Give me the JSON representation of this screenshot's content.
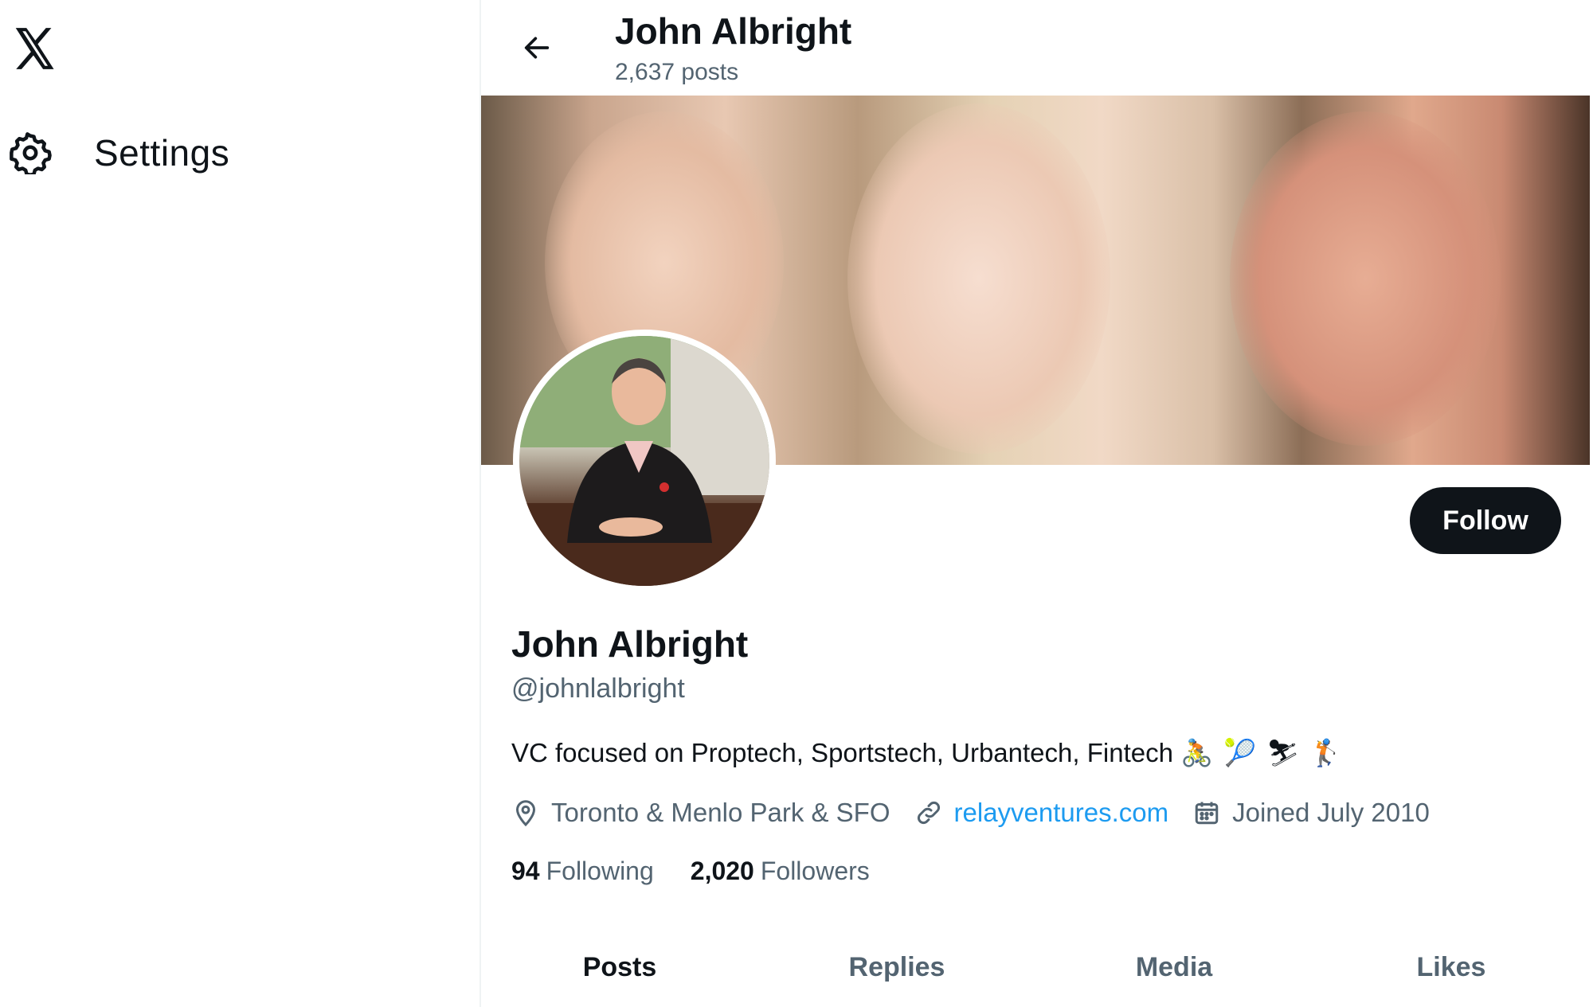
{
  "nav": {
    "settings_label": "Settings"
  },
  "header": {
    "name": "John Albright",
    "post_count": "2,637 posts"
  },
  "profile": {
    "name": "John Albright",
    "handle": "@johnlalbright",
    "bio": "VC focused on Proptech, Sportstech, Urbantech, Fintech",
    "bio_emojis": [
      "🚴",
      "🎾",
      "⛷",
      "🏌"
    ],
    "location": "Toronto & Menlo Park & SFO",
    "website": "relayventures.com",
    "joined": "Joined July 2010",
    "following_count": "94",
    "following_label": "Following",
    "followers_count": "2,020",
    "followers_label": "Followers",
    "follow_button": "Follow"
  },
  "tabs": [
    {
      "label": "Posts",
      "active": true
    },
    {
      "label": "Replies",
      "active": false
    },
    {
      "label": "Media",
      "active": false
    },
    {
      "label": "Likes",
      "active": false
    }
  ],
  "icons": {
    "logo": "x-logo-icon",
    "settings": "gear-icon",
    "back": "arrow-left-icon",
    "location": "location-pin-icon",
    "website": "link-icon",
    "joined": "calendar-icon"
  },
  "colors": {
    "text": "#0f1419",
    "secondary": "#536471",
    "link": "#1d9bf0",
    "button_bg": "#0f1419",
    "button_text": "#ffffff"
  }
}
